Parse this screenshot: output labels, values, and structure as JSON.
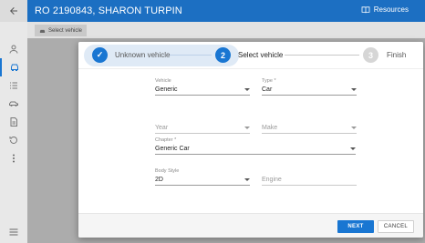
{
  "header": {
    "title": "RO 2190843, SHARON TURPIN",
    "resources_label": "Resources"
  },
  "subtoolbar": {
    "tab_label": "Select vehicle"
  },
  "sidebar": {
    "items": [
      {
        "icon": "user-icon"
      },
      {
        "icon": "car-icon"
      },
      {
        "icon": "list-icon"
      },
      {
        "icon": "vehicle-side-icon"
      },
      {
        "icon": "document-icon"
      },
      {
        "icon": "history-icon"
      },
      {
        "icon": "more-vert-icon"
      }
    ]
  },
  "stepper": {
    "steps": [
      {
        "number": "✓",
        "label": "Unknown vehicle",
        "state": "done"
      },
      {
        "number": "2",
        "label": "Select vehicle",
        "state": "active"
      },
      {
        "number": "3",
        "label": "Finish",
        "state": "pending"
      }
    ]
  },
  "form": {
    "vehicle": {
      "label": "Vehicle",
      "value": "Generic"
    },
    "type": {
      "label": "Type *",
      "value": "Car"
    },
    "year": {
      "placeholder": "Year"
    },
    "make": {
      "placeholder": "Make"
    },
    "chapter": {
      "label": "Chapter *",
      "value": "Generic Car"
    },
    "body_style": {
      "label": "Body Style",
      "value": "2D"
    },
    "engine": {
      "placeholder": "Engine"
    }
  },
  "footer": {
    "next_label": "NEXT",
    "cancel_label": "CANCEL"
  },
  "colors": {
    "primary": "#1976d2",
    "topbar": "#1c6fc2",
    "done_bg": "#dfeaf6"
  }
}
